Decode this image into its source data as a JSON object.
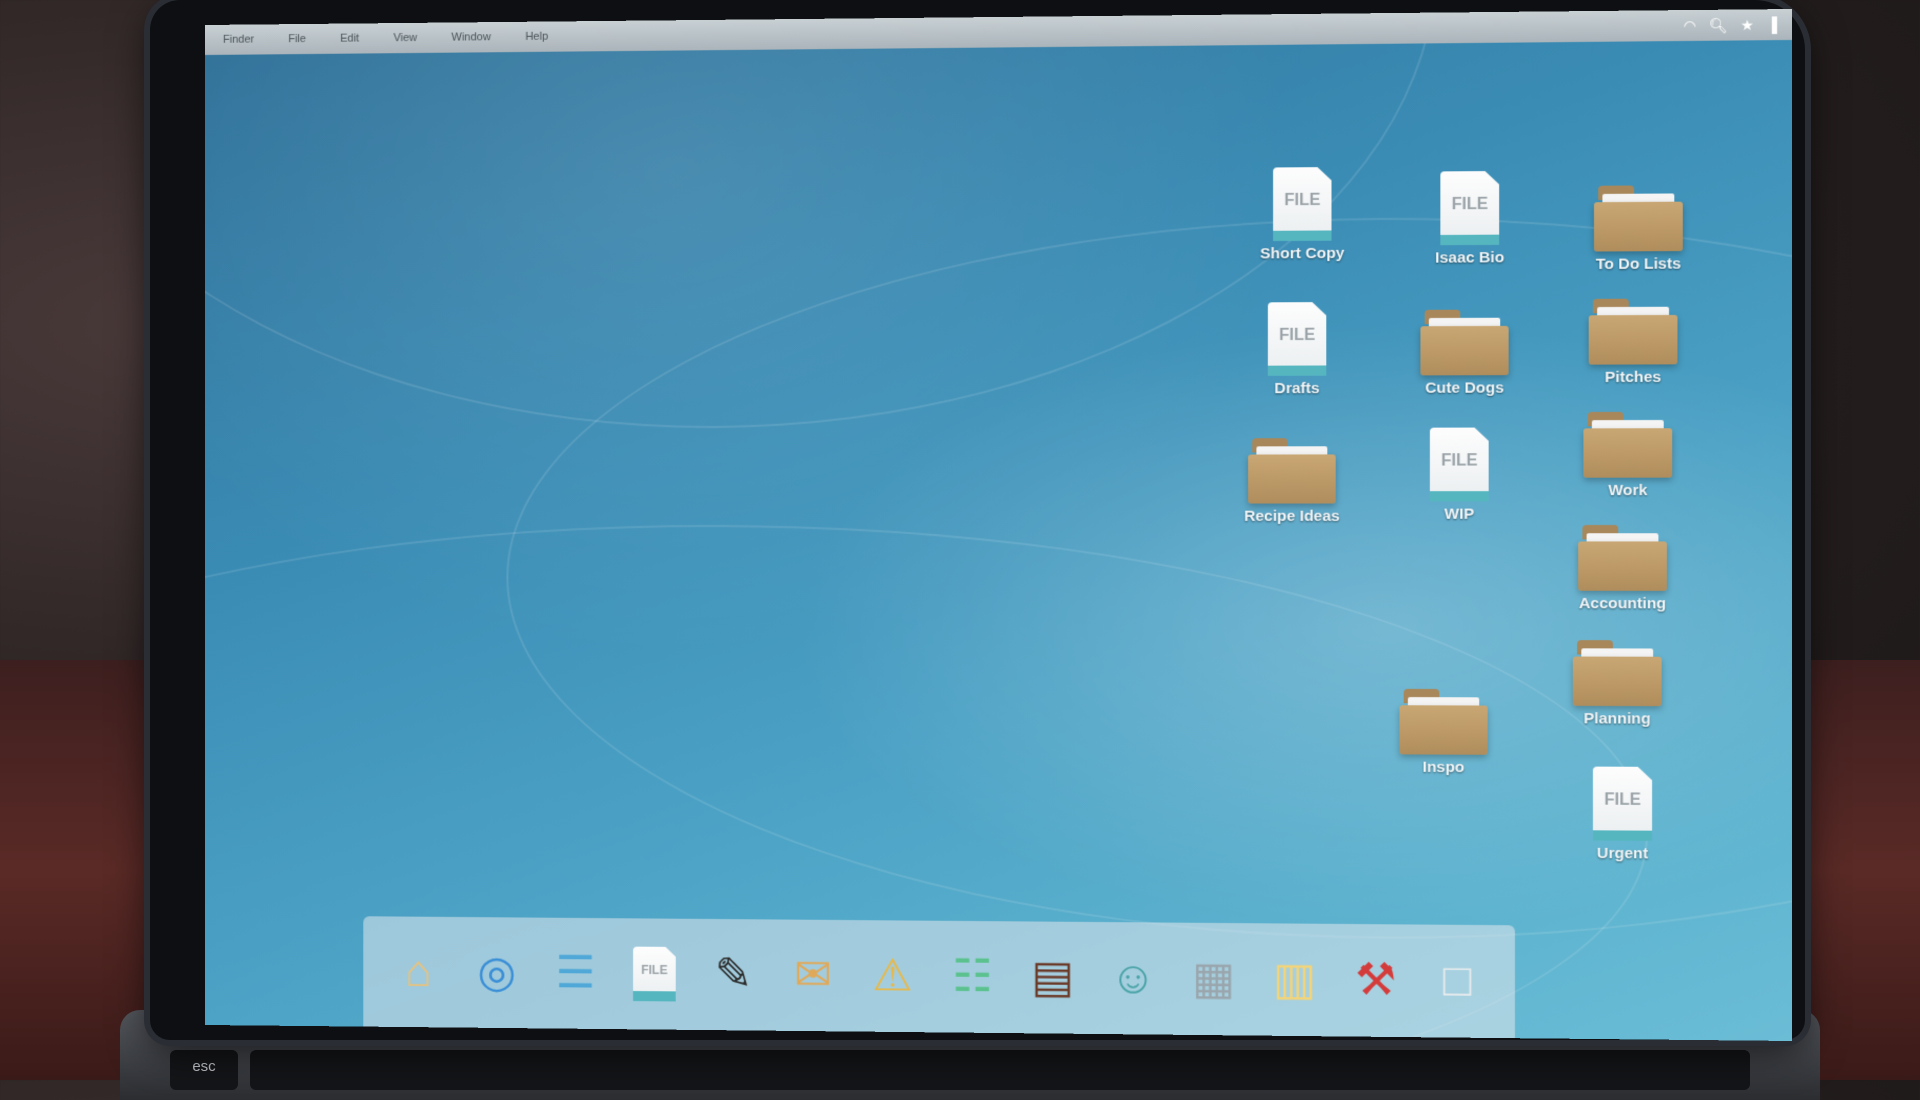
{
  "menubar": {
    "items": [
      "Finder",
      "File",
      "Edit",
      "View",
      "Window",
      "Help"
    ],
    "status_icons": [
      "wifi-icon",
      "search-icon",
      "star-icon",
      "signal-icon"
    ]
  },
  "desktop": {
    "icons": [
      {
        "type": "file",
        "label": "Short Copy",
        "badge": "FILE"
      },
      {
        "type": "file",
        "label": "Isaac Bio",
        "badge": "FILE"
      },
      {
        "type": "folder",
        "label": "To Do Lists"
      },
      {
        "type": "file",
        "label": "Drafts",
        "badge": "FILE"
      },
      {
        "type": "folder",
        "label": "Cute Dogs"
      },
      {
        "type": "folder",
        "label": "Pitches"
      },
      {
        "type": "folder",
        "label": "Recipe Ideas"
      },
      {
        "type": "file",
        "label": "WIP",
        "badge": "FILE"
      },
      {
        "type": "folder",
        "label": "Work"
      },
      {
        "type": "folder",
        "label": "Accounting"
      },
      {
        "type": "folder",
        "label": "Planning"
      },
      {
        "type": "folder",
        "label": "Inspo"
      },
      {
        "type": "file",
        "label": "Urgent",
        "badge": "FILE"
      }
    ]
  },
  "dock": {
    "items": [
      "home-icon",
      "globe-icon",
      "document-icon",
      "file-icon",
      "pen-pencil-icon",
      "mail-icon",
      "shield-alert-icon",
      "chat-icon",
      "notebook-icon",
      "contacts-icon",
      "calculator-icon",
      "notepad-icon",
      "tools-icon",
      "trash-icon"
    ],
    "file_badge": "FILE"
  },
  "keyboard": {
    "esc_label": "esc"
  }
}
